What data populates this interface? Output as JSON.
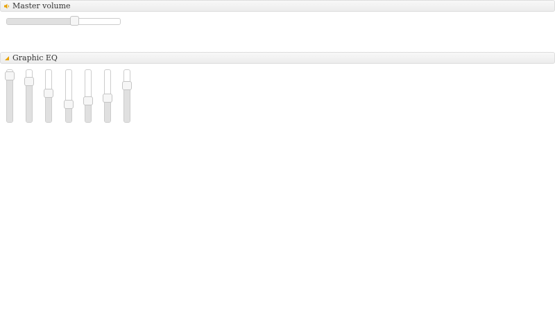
{
  "master": {
    "title": "Master volume",
    "icon": "speaker-icon",
    "value_percent": 60
  },
  "eq": {
    "title": "Graphic EQ",
    "icon": "equalizer-icon",
    "bands_percent": [
      88,
      77,
      55,
      33,
      40,
      45,
      70
    ]
  },
  "colors": {
    "icon_accent": "#e8a200",
    "header_border": "#dddddd",
    "track_fill": "#e0e0e0"
  }
}
